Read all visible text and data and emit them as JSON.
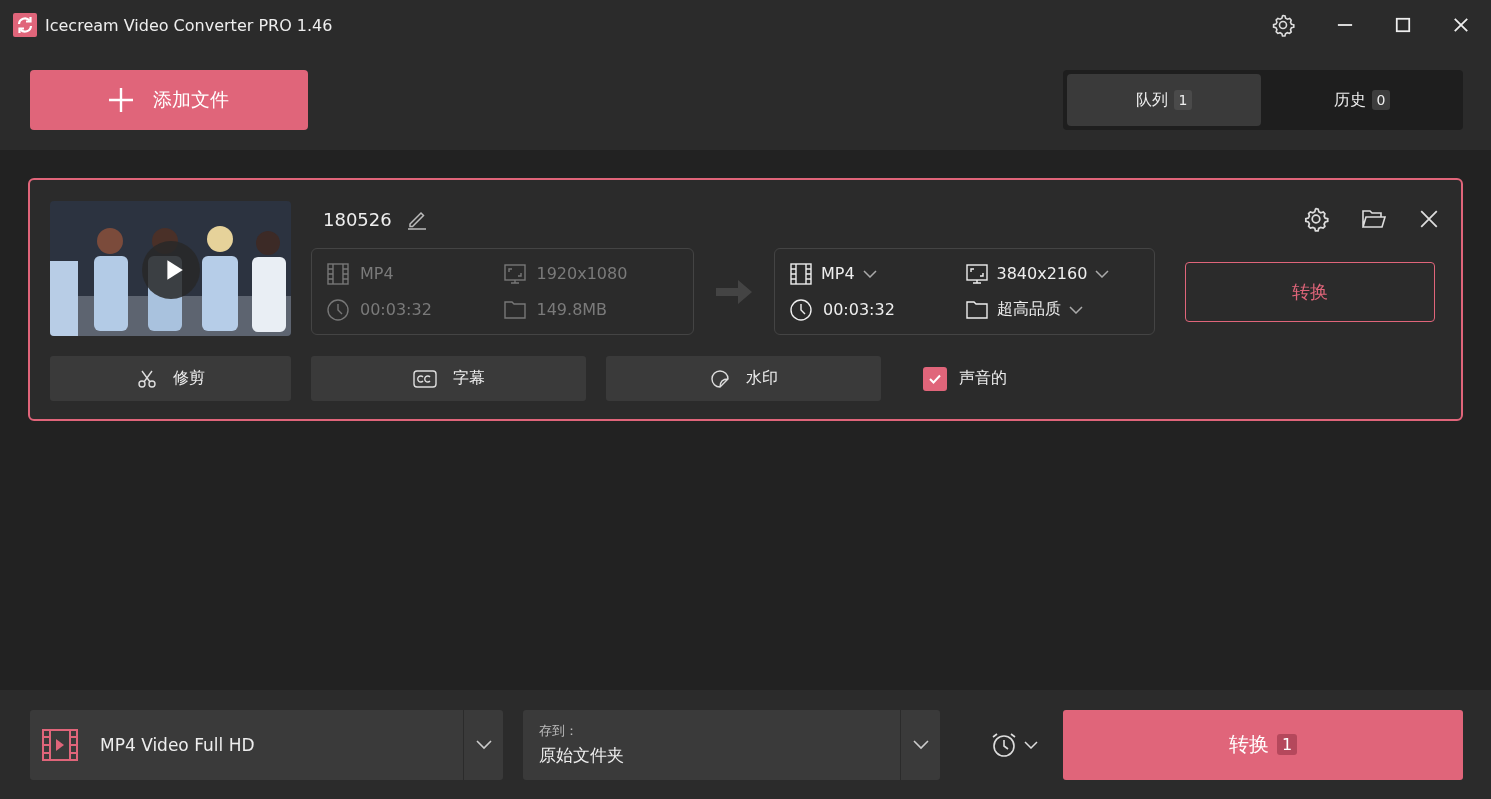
{
  "window": {
    "title": "Icecream Video Converter PRO 1.46"
  },
  "toolbar": {
    "add_button": "添加文件",
    "tabs": [
      {
        "label": "队列",
        "count": "1",
        "selected": true
      },
      {
        "label": "历史",
        "count": "0",
        "selected": false
      }
    ]
  },
  "queue": [
    {
      "name": "180526",
      "source": {
        "format": "MP4",
        "resolution": "1920x1080",
        "duration": "00:03:32",
        "size": "149.8MB"
      },
      "target": {
        "format": "MP4",
        "resolution": "3840x2160",
        "duration": "00:03:32",
        "quality": "超高品质"
      },
      "convert_button": "转换",
      "actions": [
        {
          "kind": "trim",
          "label": "修剪"
        },
        {
          "kind": "subtitles",
          "label": "字幕"
        },
        {
          "kind": "watermark",
          "label": "水印"
        }
      ],
      "audio": {
        "label": "声音的",
        "checked": true
      }
    }
  ],
  "bottom_bar": {
    "preset": "MP4 Video Full HD",
    "save_to": {
      "label": "存到：",
      "value": "原始文件夹"
    },
    "convert": {
      "label": "转换",
      "count": "1"
    }
  }
}
